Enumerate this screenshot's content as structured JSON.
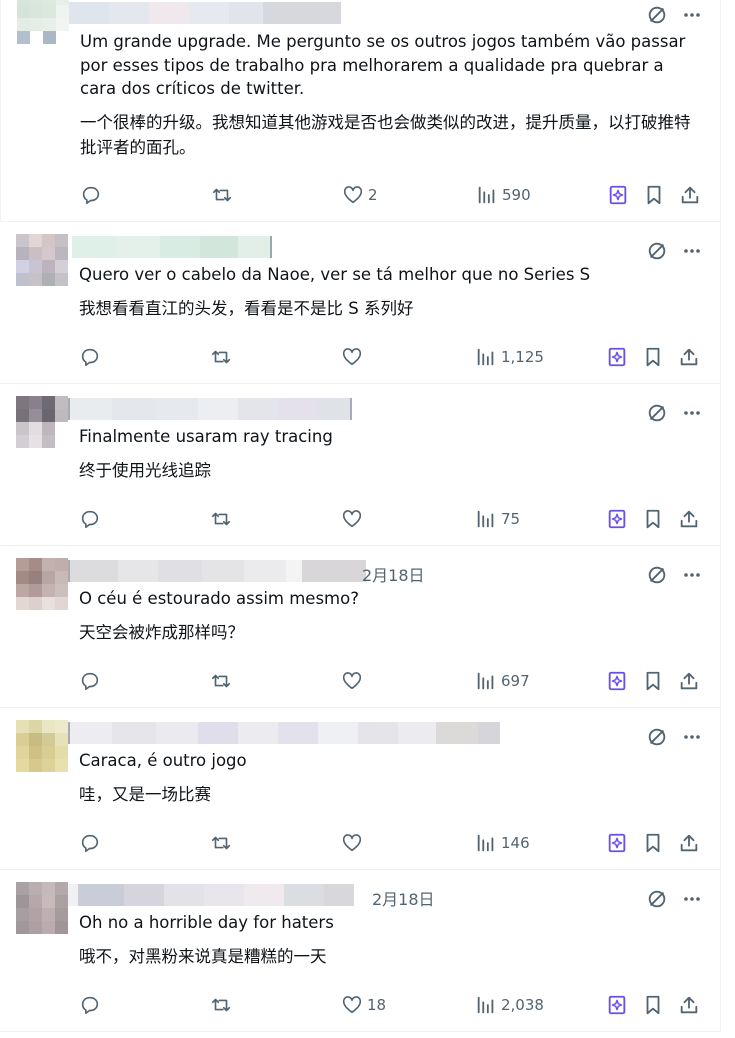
{
  "colors": {
    "text": "#0f1419",
    "muted": "#536471",
    "grok_accent": "#6b4ee6",
    "divider": "#eff3f4"
  },
  "icons": {
    "reply": "reply-icon",
    "retweet": "retweet-icon",
    "like": "heart-icon",
    "views": "views-icon",
    "grok": "grok-icon",
    "bookmark": "bookmark-icon",
    "share": "share-icon",
    "translate": "translate-icon",
    "more": "more-icon"
  },
  "tweets": [
    {
      "author_blurred": true,
      "date": "",
      "text_pt": "Um grande upgrade. Me pergunto se os outros jogos também vão passar por esses tipos de trabalho pra melhorarem a qualidade pra quebrar a cara dos críticos de twitter.",
      "text_zh": "一个很棒的升级。我想知道其他游戏是否也会做类似的改进，提升质量，以打破推特批评者的面孔。",
      "likes": "2",
      "views": "590"
    },
    {
      "author_blurred": true,
      "date": "",
      "text_pt": "Quero ver o cabelo da Naoe, ver se tá melhor que no Series S",
      "text_zh": "我想看看直江的头发，看看是不是比 S 系列好",
      "likes": "",
      "views": "1,125"
    },
    {
      "author_blurred": true,
      "date": "",
      "text_pt": "Finalmente usaram ray tracing",
      "text_zh": "终于使用光线追踪",
      "likes": "",
      "views": "75"
    },
    {
      "author_blurred": true,
      "date": "2月18日",
      "text_pt": "O céu é estourado assim mesmo?",
      "text_zh": "天空会被炸成那样吗？",
      "likes": "",
      "views": "697"
    },
    {
      "author_blurred": true,
      "date": "",
      "text_pt": "Caraca, é outro jogo",
      "text_zh": "哇，又是一场比赛",
      "likes": "",
      "views": "146"
    },
    {
      "author_blurred": true,
      "date": "2月18日",
      "text_pt": "Oh no a horrible day for haters",
      "text_zh": "哦不，对黑粉来说真是糟糕的一天",
      "likes": "18",
      "views": "2,038"
    }
  ]
}
